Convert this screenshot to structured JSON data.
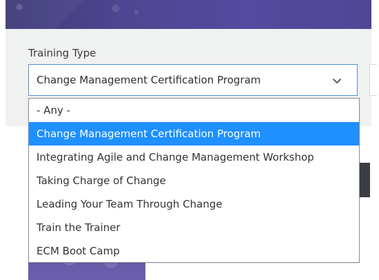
{
  "page": {
    "filters": {
      "training_type": {
        "label": "Training Type",
        "selected_value": "Change Management Certification Program",
        "dropdown_icon": "chevron-down-icon"
      }
    },
    "dropdown": {
      "options": [
        {
          "label": "- Any -"
        },
        {
          "label": "Change Management Certification Program",
          "selected": true
        },
        {
          "label": "Integrating Agile and Change Management Workshop"
        },
        {
          "label": "Taking Charge of Change"
        },
        {
          "label": "Leading Your Team Through Change"
        },
        {
          "label": "Train the Trainer"
        },
        {
          "label": "ECM Boot Camp"
        }
      ]
    },
    "colors": {
      "selected_option": "#1e90ff",
      "focus_border": "#4f8dce",
      "hero_purple": "#4d468f",
      "filter_panel": "#f0f1f1",
      "dark_block": "#3a3d43"
    }
  }
}
